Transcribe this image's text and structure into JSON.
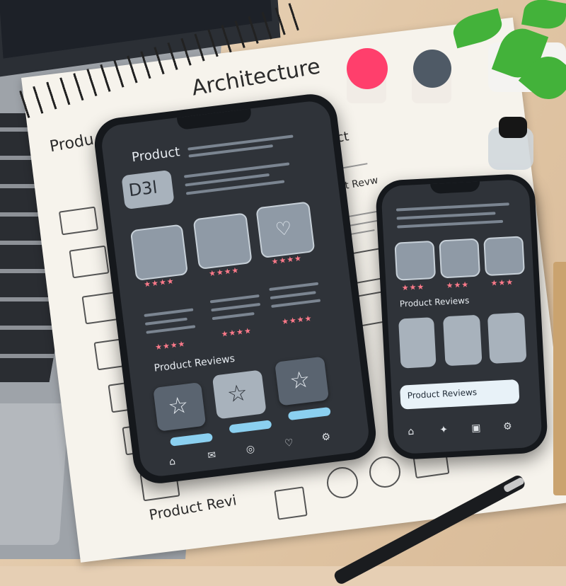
{
  "notebook": {
    "title": "Architecture",
    "top_left_label": "Produ",
    "right_label": "Product",
    "right_label_2": "Product Revw",
    "bottom_label": "Product Revi"
  },
  "phone_left": {
    "header": "Product",
    "code": "D3l",
    "section_label": "Product Reviews",
    "stars": "★★★★",
    "nav_icons": [
      "home-icon",
      "chat-icon",
      "bag-icon",
      "heart-icon",
      "settings-icon"
    ]
  },
  "phone_right": {
    "section_label": "Product Reviews",
    "button_label": "Product Reviews",
    "stars": "★★★",
    "nav_icons": [
      "home-icon",
      "gift-icon",
      "lock-icon",
      "settings-icon"
    ]
  },
  "colors": {
    "accent_blue": "#8bd0f0",
    "star_pink": "#ff7a8a",
    "screen_dark": "#2f3339",
    "plant_green": "#43b23a",
    "spool_pink": "#ff3f6c"
  }
}
